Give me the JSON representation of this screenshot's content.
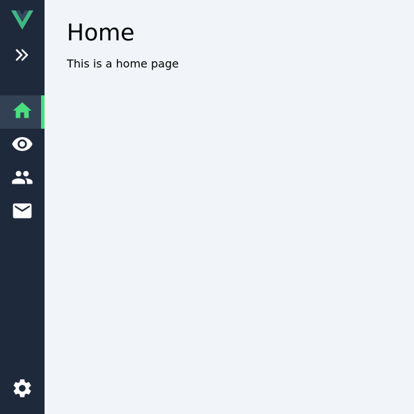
{
  "sidebar": {
    "logo_icon": "vue-logo-icon",
    "toggle_icon": "double-chevron-right-icon",
    "items": [
      {
        "icon": "home-icon",
        "active": true
      },
      {
        "icon": "eye-icon",
        "active": false
      },
      {
        "icon": "people-icon",
        "active": false
      },
      {
        "icon": "mail-icon",
        "active": false
      }
    ],
    "settings_icon": "gear-icon",
    "colors": {
      "background": "#1e293b",
      "active_background": "#334155",
      "accent": "#4ade80",
      "icon": "#ffffff"
    }
  },
  "main": {
    "title": "Home",
    "description": "This is a home page",
    "background": "#f1f5f9"
  }
}
